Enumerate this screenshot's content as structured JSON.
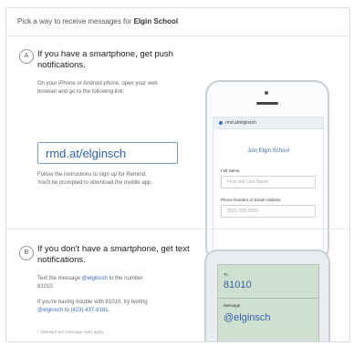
{
  "header": {
    "prefix": "Pick a way to receive messages for ",
    "org": "Elgin School"
  },
  "section_a": {
    "badge": "A",
    "title": "If you have a smartphone, get push notifications.",
    "instructions": "On your iPhone or Android phone, open your web browser and go to the following link:",
    "short_link": "rmd.at/elginsch",
    "follow_up": "Follow the instructions to sign up for Remind. You'll be prompted to download the mobile app.",
    "phone": {
      "url": "rmd.at/elginsch",
      "join_text": "Join Elgin School",
      "full_name_label": "Full Name",
      "full_name_placeholder": "First and Last Name",
      "contact_label": "Phone Number or Email Address",
      "contact_placeholder": "(555) 555-5555"
    }
  },
  "section_b": {
    "badge": "B",
    "title": "If you don't have a smartphone, get text notifications.",
    "text_prefix": "Text the message ",
    "text_code": "@elginsch",
    "text_mid": " to the number ",
    "text_number": "81010",
    "text_end": ".",
    "trouble_prefix": "If you're having trouble with 81010, try texting ",
    "trouble_code": "@elginsch",
    "trouble_mid": " to ",
    "trouble_number": "(423) 437-8181",
    "trouble_end": ".",
    "footnote": "* Standard text message rates apply.",
    "phone": {
      "to_label": "To",
      "to_value": "81010",
      "message_label": "Message",
      "message_value": "@elginsch"
    }
  }
}
